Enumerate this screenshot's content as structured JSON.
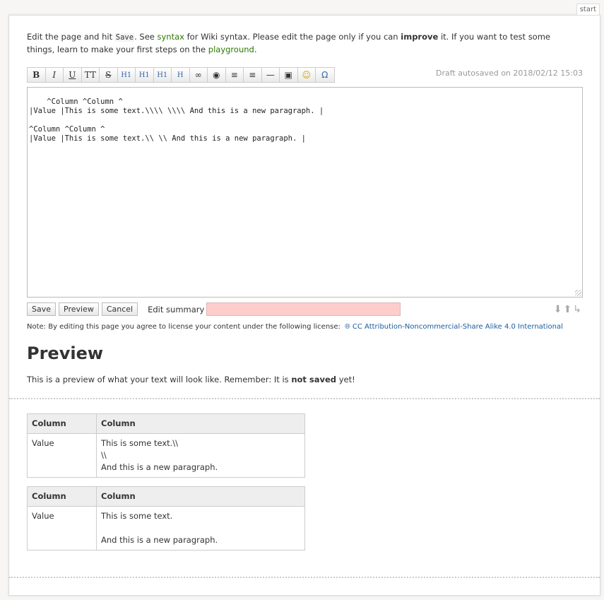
{
  "page_tab": "start",
  "intro": {
    "part1": "Edit the page and hit ",
    "save_code": "Save",
    "part2": ". See ",
    "syntax_link": "syntax",
    "part3": " for Wiki syntax. Please edit the page only if you can ",
    "improve": "improve",
    "part4": " it. If you want to test some things, learn to make your first steps on the ",
    "playground_link": "playground",
    "part5": "."
  },
  "toolbar": {
    "buttons": [
      {
        "name": "bold-button",
        "glyph": "B"
      },
      {
        "name": "italic-button",
        "glyph": "I"
      },
      {
        "name": "underline-button",
        "glyph": "U"
      },
      {
        "name": "monospace-button",
        "glyph": "TT"
      },
      {
        "name": "strikethrough-button",
        "glyph": "S"
      },
      {
        "name": "same-level-heading-button",
        "glyph": "H1"
      },
      {
        "name": "lower-heading-button",
        "glyph": "H1"
      },
      {
        "name": "higher-heading-button",
        "glyph": "H1"
      },
      {
        "name": "select-heading-button",
        "glyph": "H"
      },
      {
        "name": "link-button",
        "glyph": "∞"
      },
      {
        "name": "external-link-button",
        "glyph": "◉"
      },
      {
        "name": "ordered-list-button",
        "glyph": "≡"
      },
      {
        "name": "unordered-list-button",
        "glyph": "≡"
      },
      {
        "name": "horizontal-rule-button",
        "glyph": "—"
      },
      {
        "name": "add-image-button",
        "glyph": "▣"
      },
      {
        "name": "smileys-button",
        "glyph": "☺"
      },
      {
        "name": "special-chars-button",
        "glyph": "Ω"
      }
    ]
  },
  "draft_note": "Draft autosaved on 2018/02/12 15:03",
  "editor": {
    "content": "^Column ^Column ^\n|Value |This is some text.\\\\\\\\ \\\\\\\\ And this is a new paragraph. |\n\n^Column ^Column ^\n|Value |This is some text.\\\\ \\\\ And this is a new paragraph. |"
  },
  "actions": {
    "save": "Save",
    "preview": "Preview",
    "cancel": "Cancel",
    "summary_label": "Edit summary",
    "summary_value": ""
  },
  "license": {
    "note": "Note: By editing this page you agree to license your content under the following license:",
    "link": "CC Attribution-Noncommercial-Share Alike 4.0 International"
  },
  "preview": {
    "title": "Preview",
    "text_part1": "This is a preview of what your text will look like. Remember: It is ",
    "not_saved": "not saved",
    "text_part2": " yet!"
  },
  "tables": [
    {
      "headers": [
        "Column",
        "Column"
      ],
      "cell1": "Value",
      "lines": [
        "This is some text.\\\\",
        "\\\\",
        "And this is a new paragraph."
      ]
    },
    {
      "headers": [
        "Column",
        "Column"
      ],
      "cell1": "Value",
      "lines": [
        "This is some text.",
        "",
        "And this is a new paragraph."
      ]
    }
  ]
}
